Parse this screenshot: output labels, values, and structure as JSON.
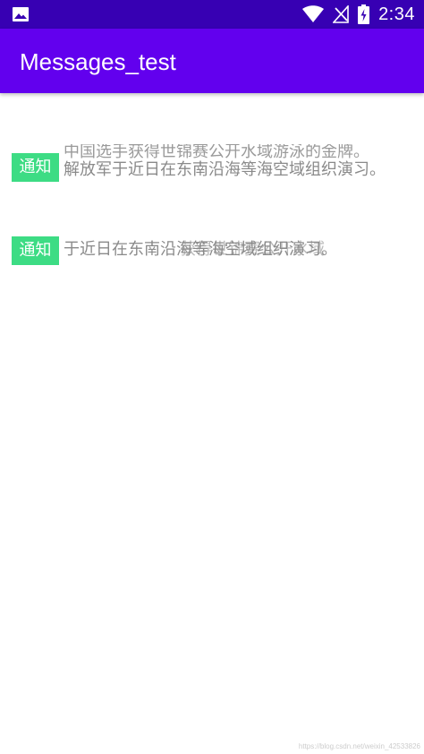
{
  "status_bar": {
    "time": "2:34",
    "icons": [
      "image-icon",
      "wifi-icon",
      "no-signal-icon",
      "battery-charging-icon"
    ]
  },
  "app_bar": {
    "title": "Messages_test"
  },
  "messages": [
    {
      "badge": "通知",
      "line_a": "中国选手获得世锦赛公开水域游泳的金牌。",
      "line_b": "解放军于近日在东南沿海等海空域组织演习。"
    },
    {
      "badge": "通知",
      "line_a": "于近日在东南沿海等海空域组织演习。",
      "line_b": "获得世锦赛公开水域"
    }
  ],
  "watermark": "https://blog.csdn.net/weixin_42533826",
  "colors": {
    "status_bar": "#3700B3",
    "app_bar": "#6200EE",
    "badge": "#3DDC84"
  }
}
